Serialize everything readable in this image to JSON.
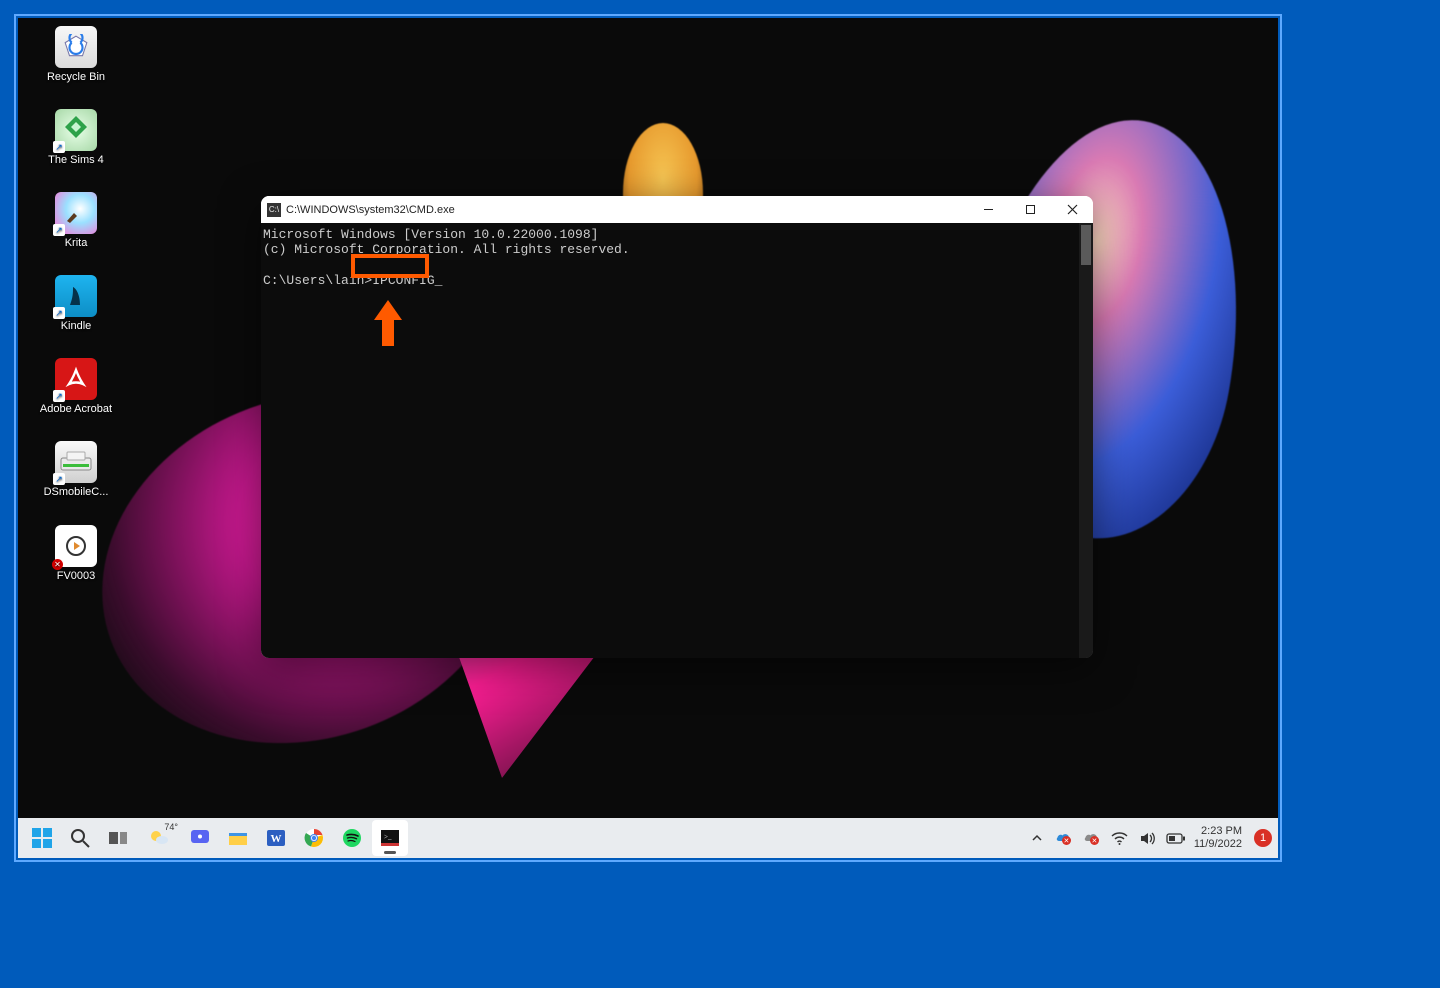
{
  "desktop": {
    "icons": [
      {
        "label": "Recycle Bin"
      },
      {
        "label": "The Sims 4"
      },
      {
        "label": "Krita"
      },
      {
        "label": "Kindle"
      },
      {
        "label": "Adobe Acrobat"
      },
      {
        "label": "DSmobileC..."
      },
      {
        "label": "FV0003"
      }
    ]
  },
  "cmd": {
    "title": "C:\\WINDOWS\\system32\\CMD.exe",
    "line1": "Microsoft Windows [Version 10.0.22000.1098]",
    "line2": "(c) Microsoft Corporation. All rights reserved.",
    "prompt_prefix": "C:\\Users\\lain",
    "prompt_gt": ">",
    "command": "IPCONFIG",
    "cursor": "_"
  },
  "taskbar": {
    "weather_temp": "74°"
  },
  "clock": {
    "time": "2:23 PM",
    "date": "11/9/2022"
  },
  "notif_count": "1"
}
